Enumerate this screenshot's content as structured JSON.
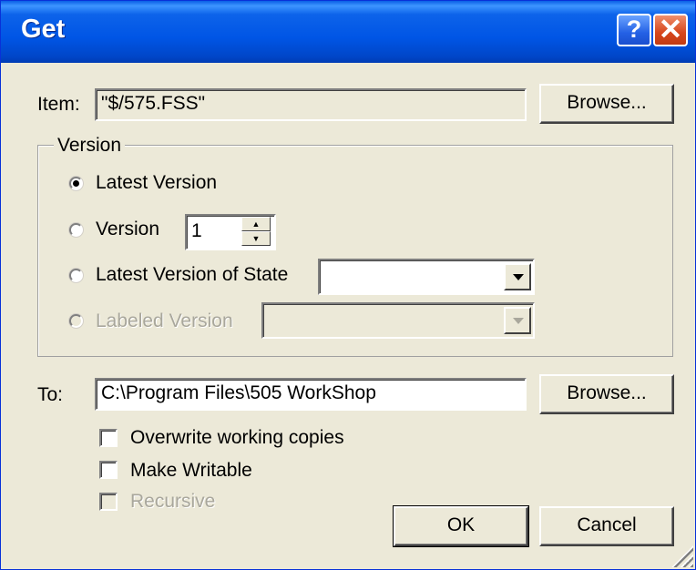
{
  "window": {
    "title": "Get",
    "help_glyph": "?",
    "close_glyph": "✕"
  },
  "item": {
    "label": "Item:",
    "value": "\"$/575.FSS\"",
    "browse_label": "Browse..."
  },
  "version_group": {
    "legend": "Version",
    "options": [
      {
        "label": "Latest Version",
        "selected": true,
        "enabled": true
      },
      {
        "label": "Version",
        "selected": false,
        "enabled": true
      },
      {
        "label": "Latest Version of State",
        "selected": false,
        "enabled": true
      },
      {
        "label": "Labeled Version",
        "selected": false,
        "enabled": false
      }
    ],
    "version_number": "1",
    "state_value": "",
    "label_value": ""
  },
  "to": {
    "label": "To:",
    "value": "C:\\Program Files\\505 WorkShop",
    "browse_label": "Browse..."
  },
  "checkboxes": [
    {
      "label": "Overwrite working copies",
      "checked": false,
      "enabled": true
    },
    {
      "label": "Make Writable",
      "checked": false,
      "enabled": true
    },
    {
      "label": "Recursive",
      "checked": false,
      "enabled": false
    }
  ],
  "buttons": {
    "ok": "OK",
    "cancel": "Cancel"
  },
  "colors": {
    "titlebar": "#0055e5",
    "face": "#ece9d8",
    "disabled_text": "#a9a79c",
    "close": "#d7461c"
  }
}
